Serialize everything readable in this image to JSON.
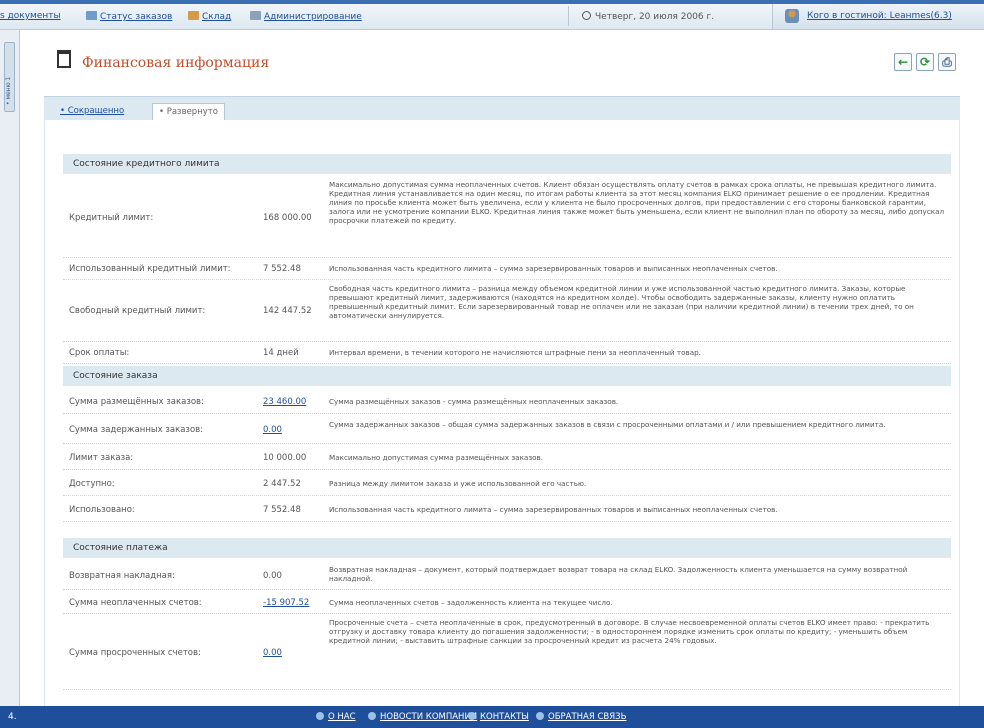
{
  "nav": {
    "items": [
      {
        "label": "s документы"
      },
      {
        "label": "Статус заказов"
      },
      {
        "label": "Склад"
      },
      {
        "label": "Администрирование"
      }
    ],
    "date": "Четверг, 20 июля 2006 г.",
    "user": "Кого в гостиной: Lеанmes(6.3)"
  },
  "sidebar": {
    "tab_label": "• меню 1"
  },
  "page": {
    "title": "Финансовая информация",
    "tools": {
      "back": "←",
      "refresh": "⟳",
      "print": "⎙"
    }
  },
  "tabs": [
    {
      "label": "• Сокращенно"
    },
    {
      "label": "• Развернуто"
    }
  ],
  "sections": [
    {
      "title": "Состояние кредитного лимита",
      "rows": [
        {
          "label": "Кредитный лимит:",
          "value": "168 000.00",
          "desc": "Максимально допустимая сумма неоплаченных счетов. Клиент обязан осуществлять оплату счетов в рамках срока оплаты, не превышая кредитного лимита. Кредитная линия устанавливается на один месяц, по итогам работы клиента за этот месяц компания ELKO принимает решение о ее продлении. Кредитная линия по просьбе клиента может быть увеличена, если у клиента не было просроченных долгов, при предоставлении с его стороны банковской гарантии, залога или не усмотрение компании ELKO. Кредитная линия также может быть уменьшена, если клиент не выполнил план по обороту за месяц, либо допускал просрочки платежей по кредиту."
        },
        {
          "label": "Использованный кредитный лимит:",
          "value": "7 552.48",
          "desc": "Использованная часть кредитного лимита – сумма зарезервированных товаров и выписанных неоплаченных счетов."
        },
        {
          "label": "Свободный кредитный лимит:",
          "value": "142 447.52",
          "desc": "Свободная часть кредитного лимита – разница между объемом кредитной линии и уже использованной частью кредитного лимита. Заказы, которые превышают кредитный лимит, задерживаются (находятся на кредитном холде). Чтобы освободить задержанные заказы, клиенту нужно оплатить превышенный кредитный лимит. Если зарезервированный товар не оплачен или не заказан (при наличии кредитной линии) в течении трех дней, то он автоматически аннулируется."
        },
        {
          "label": "Срок оплаты:",
          "value": "14 дней",
          "desc": "Интервал времени, в течении которого не начисляются штрафные пени за неоплаченный товар."
        }
      ]
    },
    {
      "title": "Состояние заказа",
      "rows": [
        {
          "label": "Сумма размещённых заказов:",
          "value": "23 460.00",
          "desc": "Сумма размещённых заказов - сумма размещённых неоплаченных заказов."
        },
        {
          "label": "Сумма задержанных заказов:",
          "value": "0.00",
          "desc": "Сумма задержанных заказов – общая сумма задержанных заказов в связи с просроченными оплатами и / или превышением кредитного лимита."
        },
        {
          "label": "Лимит заказа:",
          "value": "10 000.00",
          "desc": "Максимально допустимая сумма размещённых заказов."
        },
        {
          "label": "Доступно:",
          "value": "2 447.52",
          "desc": "Разница между лимитом заказа и уже использованной его частью."
        },
        {
          "label": "Использовано:",
          "value": "7 552.48",
          "desc": "Использованная часть кредитного лимита – сумма зарезервированных товаров и выписанных неоплаченных счетов."
        }
      ]
    },
    {
      "title": "Состояние платежа",
      "rows": [
        {
          "label": "Возвратная накладная:",
          "value": "0.00",
          "desc": "Возвратная накладная – документ, который подтверждает возврат товара на склад ELKO. Задолженность клиента уменьшается на сумму возвратной накладной."
        },
        {
          "label": "Сумма неоплаченных счетов:",
          "value": "-15 907.52",
          "desc": "Сумма неоплаченных счетов – задолженность клиента на текущее число."
        },
        {
          "label": "Сумма просроченных счетов:",
          "value": "0.00",
          "desc": "Просроченные счета – счета неоплаченные в срок, предусмотренный в договоре. В случае несвоевременной оплаты счетов ELKO имеет право: - прекратить отгрузку и доставку товара клиенту до погашения задолженности; - в одностороннем порядке изменить срок оплаты по кредиту; - уменьшить объем кредитной линии; - выставить штрафные санкции за просроченный кредит из расчета 24% годовых."
        }
      ]
    }
  ],
  "footer": {
    "edge": "4.",
    "links": [
      {
        "label": "О НАС"
      },
      {
        "label": "НОВОСТИ КОМПАНИИ"
      },
      {
        "label": "КОНТАКТЫ"
      },
      {
        "label": "ОБРАТНАЯ СВЯЗЬ"
      }
    ]
  }
}
